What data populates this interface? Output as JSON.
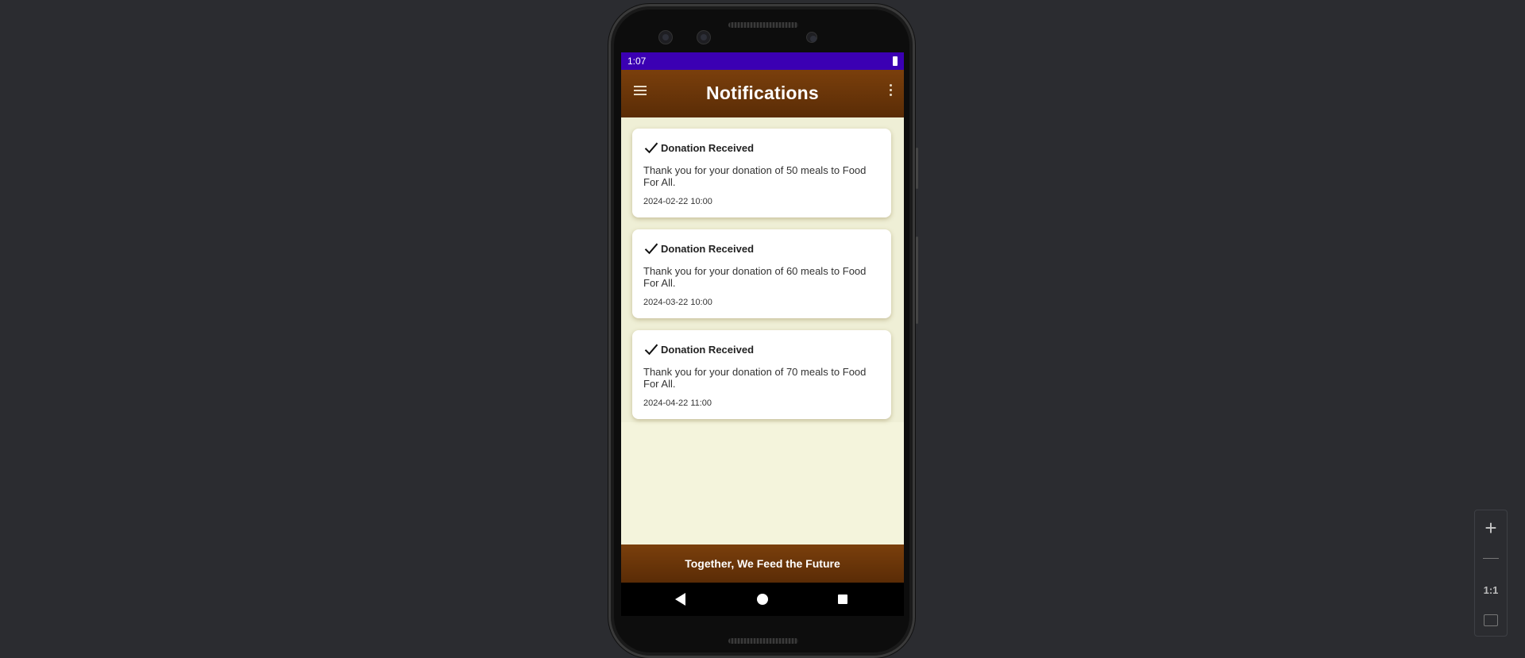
{
  "status_bar": {
    "time": "1:07"
  },
  "app_bar": {
    "title": "Notifications"
  },
  "notifications": [
    {
      "title": "Donation Received",
      "message": "Thank you for your donation of 50 meals to Food For All.",
      "date": "2024-02-22 10:00"
    },
    {
      "title": "Donation Received",
      "message": "Thank you for your donation of 60 meals to Food For All.",
      "date": "2024-03-22 10:00"
    },
    {
      "title": "Donation Received",
      "message": "Thank you for your donation of 70 meals to Food For All.",
      "date": "2024-04-22 11:00"
    }
  ],
  "footer": {
    "text": "Together, We Feed the Future"
  },
  "zoom_toolbar": {
    "plus": "+",
    "one_to_one": "1:1"
  },
  "icons": {
    "menu": "hamburger-menu-icon",
    "overflow": "more-vert-icon",
    "notification": "check-icon",
    "nav_back": "back-triangle-icon",
    "nav_home": "home-circle-icon",
    "nav_recent": "recents-square-icon"
  },
  "colors": {
    "status_bar": "#3b00b3",
    "app_bar": "#6b350a",
    "background": "#f4f4dc",
    "card": "#ffffff"
  }
}
